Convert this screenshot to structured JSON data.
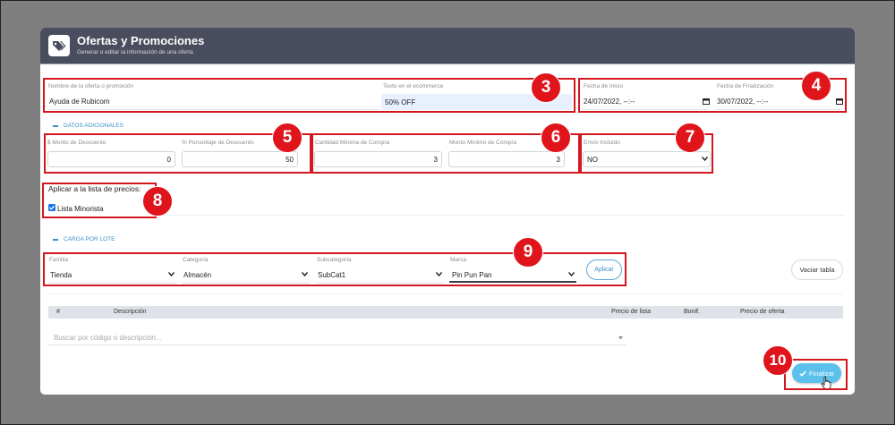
{
  "header": {
    "title": "Ofertas y Promociones",
    "subtitle": "Generar o editar la información de una oferta",
    "icon": "tag-icon"
  },
  "offer": {
    "name_label": "Nombre de la oferta o promoción",
    "name_value": "Ayuda de Rubicom",
    "ecommerce_label": "Texto en el ecommerce",
    "ecommerce_value": "50% OFF",
    "start_label": "Fecha de Inicio",
    "start_value": "24/07/2022, --:--",
    "end_label": "Fecha de Finalización",
    "end_value": "30/07/2022, --:--"
  },
  "additional": {
    "section_title": "DATOS ADICIONALES",
    "discount_amount_label": "$ Monto de Descuento",
    "discount_amount_value": "0",
    "discount_percent_label": "% Porcentaje de Descuento",
    "discount_percent_value": "50",
    "min_qty_label": "Cantidad Mínima de Compra",
    "min_qty_value": "3",
    "min_amount_label": "Monto Mínimo de Compra",
    "min_amount_value": "3",
    "shipping_label": "Envío Incluido",
    "shipping_value": "NO"
  },
  "price_list": {
    "label": "Aplicar a la lista de precios:",
    "option": "Lista Minorista",
    "checked": true
  },
  "batch": {
    "section_title": "CARGA POR LOTE",
    "family_label": "Familia",
    "family_value": "Tienda",
    "category_label": "Categoría",
    "category_value": "Almacén",
    "subcategory_label": "Subcategoría",
    "subcategory_value": "SubCat1",
    "brand_label": "Marca",
    "brand_value": "Pin Pun Pan",
    "apply_label": "Aplicar",
    "clear_label": "Vaciar tabla"
  },
  "table": {
    "columns": [
      "#",
      "Descripción",
      "Precio de lista",
      "Bonif.",
      "Precio de oferta"
    ],
    "search_placeholder": "Buscar por código o descripción..."
  },
  "finish": {
    "label": "Finalizar"
  },
  "badges": [
    "3",
    "4",
    "5",
    "6",
    "7",
    "8",
    "9",
    "10"
  ],
  "colors": {
    "header_bg": "#4a4d5e",
    "accent": "#3a8fc8",
    "finish_button": "#5bc0ec",
    "highlight": "#d4171e"
  }
}
